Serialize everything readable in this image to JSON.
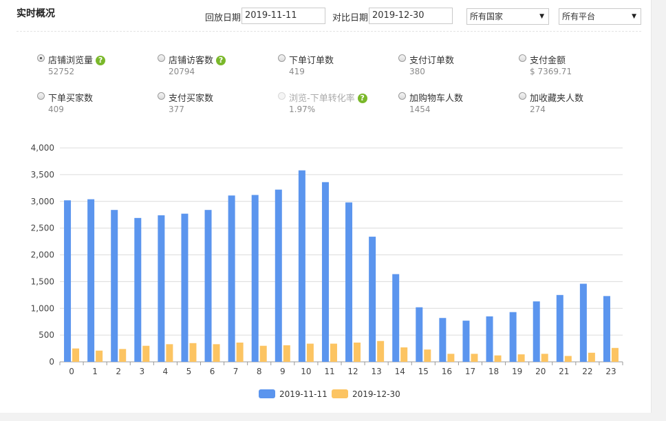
{
  "header": {
    "title": "实时概况",
    "replay_label": "回放日期",
    "replay_date": "2019-11-11",
    "compare_label": "对比日期",
    "compare_date": "2019-12-30",
    "country_select": "所有国家",
    "platform_select": "所有平台"
  },
  "metrics": [
    {
      "label": "店铺浏览量",
      "value": "52752",
      "help": true,
      "checked": true,
      "disabled": false
    },
    {
      "label": "店铺访客数",
      "value": "20794",
      "help": true,
      "checked": false,
      "disabled": false
    },
    {
      "label": "下单订单数",
      "value": "419",
      "help": false,
      "checked": false,
      "disabled": false
    },
    {
      "label": "支付订单数",
      "value": "380",
      "help": false,
      "checked": false,
      "disabled": false
    },
    {
      "label": "支付金额",
      "value": "$ 7369.71",
      "help": false,
      "checked": false,
      "disabled": false
    },
    {
      "label": "下单买家数",
      "value": "409",
      "help": false,
      "checked": false,
      "disabled": false
    },
    {
      "label": "支付买家数",
      "value": "377",
      "help": false,
      "checked": false,
      "disabled": false
    },
    {
      "label": "浏览-下单转化率",
      "value": "1.97%",
      "help": true,
      "checked": false,
      "disabled": true
    },
    {
      "label": "加购物车人数",
      "value": "1454",
      "help": false,
      "checked": false,
      "disabled": false
    },
    {
      "label": "加收藏夹人数",
      "value": "274",
      "help": false,
      "checked": false,
      "disabled": false
    }
  ],
  "chart_data": {
    "type": "bar",
    "categories": [
      "0",
      "1",
      "2",
      "3",
      "4",
      "5",
      "6",
      "7",
      "8",
      "9",
      "10",
      "11",
      "12",
      "13",
      "14",
      "15",
      "16",
      "17",
      "18",
      "19",
      "20",
      "21",
      "22",
      "23"
    ],
    "ylim": [
      0,
      4000
    ],
    "yticks": [
      "0",
      "500",
      "1,000",
      "1,500",
      "2,000",
      "2,500",
      "3,000",
      "3,500",
      "4,000"
    ],
    "ytick_values": [
      0,
      500,
      1000,
      1500,
      2000,
      2500,
      3000,
      3500,
      4000
    ],
    "grid": true,
    "legend_position": "bottom",
    "series": [
      {
        "name": "2019-11-11",
        "color": "#5b95ee",
        "values": [
          3020,
          3040,
          2840,
          2690,
          2740,
          2770,
          2840,
          3110,
          3120,
          3220,
          3580,
          3360,
          2980,
          2340,
          1640,
          1020,
          820,
          770,
          850,
          930,
          1130,
          1250,
          1460,
          1230
        ]
      },
      {
        "name": "2019-12-30",
        "color": "#fcc462",
        "values": [
          250,
          210,
          240,
          300,
          330,
          350,
          330,
          360,
          300,
          310,
          340,
          340,
          360,
          390,
          270,
          230,
          150,
          150,
          120,
          140,
          150,
          110,
          170,
          260
        ]
      }
    ]
  }
}
